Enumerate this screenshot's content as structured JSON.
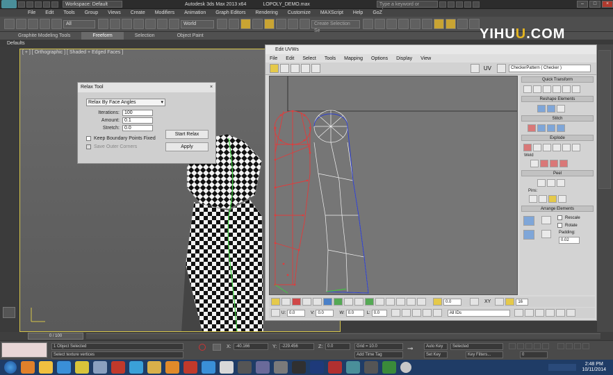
{
  "titlebar": {
    "workspace": "Workspace: Default",
    "app_title": "Autodesk 3ds Max  2013 x64",
    "file_name": "LOPOLY_DEMO.max",
    "search_placeholder": "Type a keyword or phrase"
  },
  "menubar": {
    "items": [
      "File",
      "Edit",
      "Tools",
      "Group",
      "Views",
      "Create",
      "Modifiers",
      "Animation",
      "Graph Editors",
      "Rendering",
      "Customize",
      "MAXScript",
      "Help",
      "GoZ"
    ]
  },
  "toolbar": {
    "filter_value": "All",
    "coord_value": "World",
    "selection_set_placeholder": "Create Selection Se"
  },
  "ribbon": {
    "tabs": [
      "Graphite Modeling Tools",
      "Freeform",
      "Selection",
      "Object Paint"
    ],
    "defaults_label": "Defaults"
  },
  "viewport": {
    "label": "[ + ] [ Orthographic ] [ Shaded + Edged Faces ]"
  },
  "relax_dialog": {
    "title": "Relax Tool",
    "method": "Relax By Face Angles",
    "iterations_label": "Iterations:",
    "iterations_value": "100",
    "amount_label": "Amount:",
    "amount_value": "0.1",
    "stretch_label": "Stretch:",
    "stretch_value": "0.0",
    "keep_boundary_label": "Keep Boundary Points Fixed",
    "save_outer_label": "Save Outer Corners",
    "start_label": "Start Relax",
    "apply_label": "Apply"
  },
  "uvw_editor": {
    "title": "Edit UVWs",
    "menu": [
      "File",
      "Edit",
      "Select",
      "Tools",
      "Mapping",
      "Options",
      "Display",
      "View"
    ],
    "uv_label": "UV",
    "checker_value": "CheckerPattern  ( Checker )",
    "panels": {
      "quick_transform": "Quick Transform",
      "reshape": "Reshape Elements",
      "stitch": "Stitch",
      "explode": "Explode",
      "weld": "Weld",
      "peel": "Peel",
      "pins": "Pins:",
      "arrange": "Arrange Elements",
      "rescale": "Rescale",
      "rotate": "Rotate",
      "padding": "Padding:",
      "padding_value": "0.02"
    },
    "bottom": {
      "u_label": "U:",
      "v_label": "V:",
      "w_label": "W:",
      "u_value": "0.0",
      "v_value": "0.0",
      "w_value": "0.0",
      "l_label": "L:",
      "field_value": "0.0",
      "zoom_value": "16",
      "xy_label": "XY",
      "id_filter": "All IDs"
    }
  },
  "watermark": {
    "part1": "YIHU",
    "part2": "U",
    "part3": ".COM"
  },
  "status": {
    "frame_counter": "0 / 100",
    "selected_text": "1 Object Selected",
    "prompt_text": "Select texture vertices",
    "x_label": "X:",
    "x_value": "-40.166",
    "y_label": "Y:",
    "y_value": "-229.456",
    "z_label": "Z:",
    "z_value": "0.0",
    "grid_text": "Grid = 10.0",
    "add_time_tag": "Add Time Tag",
    "auto_key": "Auto Key",
    "set_key": "Set Key",
    "key_filters": "Key Filters...",
    "selected_dropdown": "Selected",
    "frame_value": "0"
  },
  "taskbar": {
    "time": "2:48 PM",
    "date": "10/11/2014"
  },
  "colors": {
    "viewport_border": "#d6c54a",
    "accent_yellow": "#e5c94a",
    "uv_red": "#e03c3c",
    "uv_blue": "#2d3fd0",
    "taskbar": "#1f3c66"
  }
}
